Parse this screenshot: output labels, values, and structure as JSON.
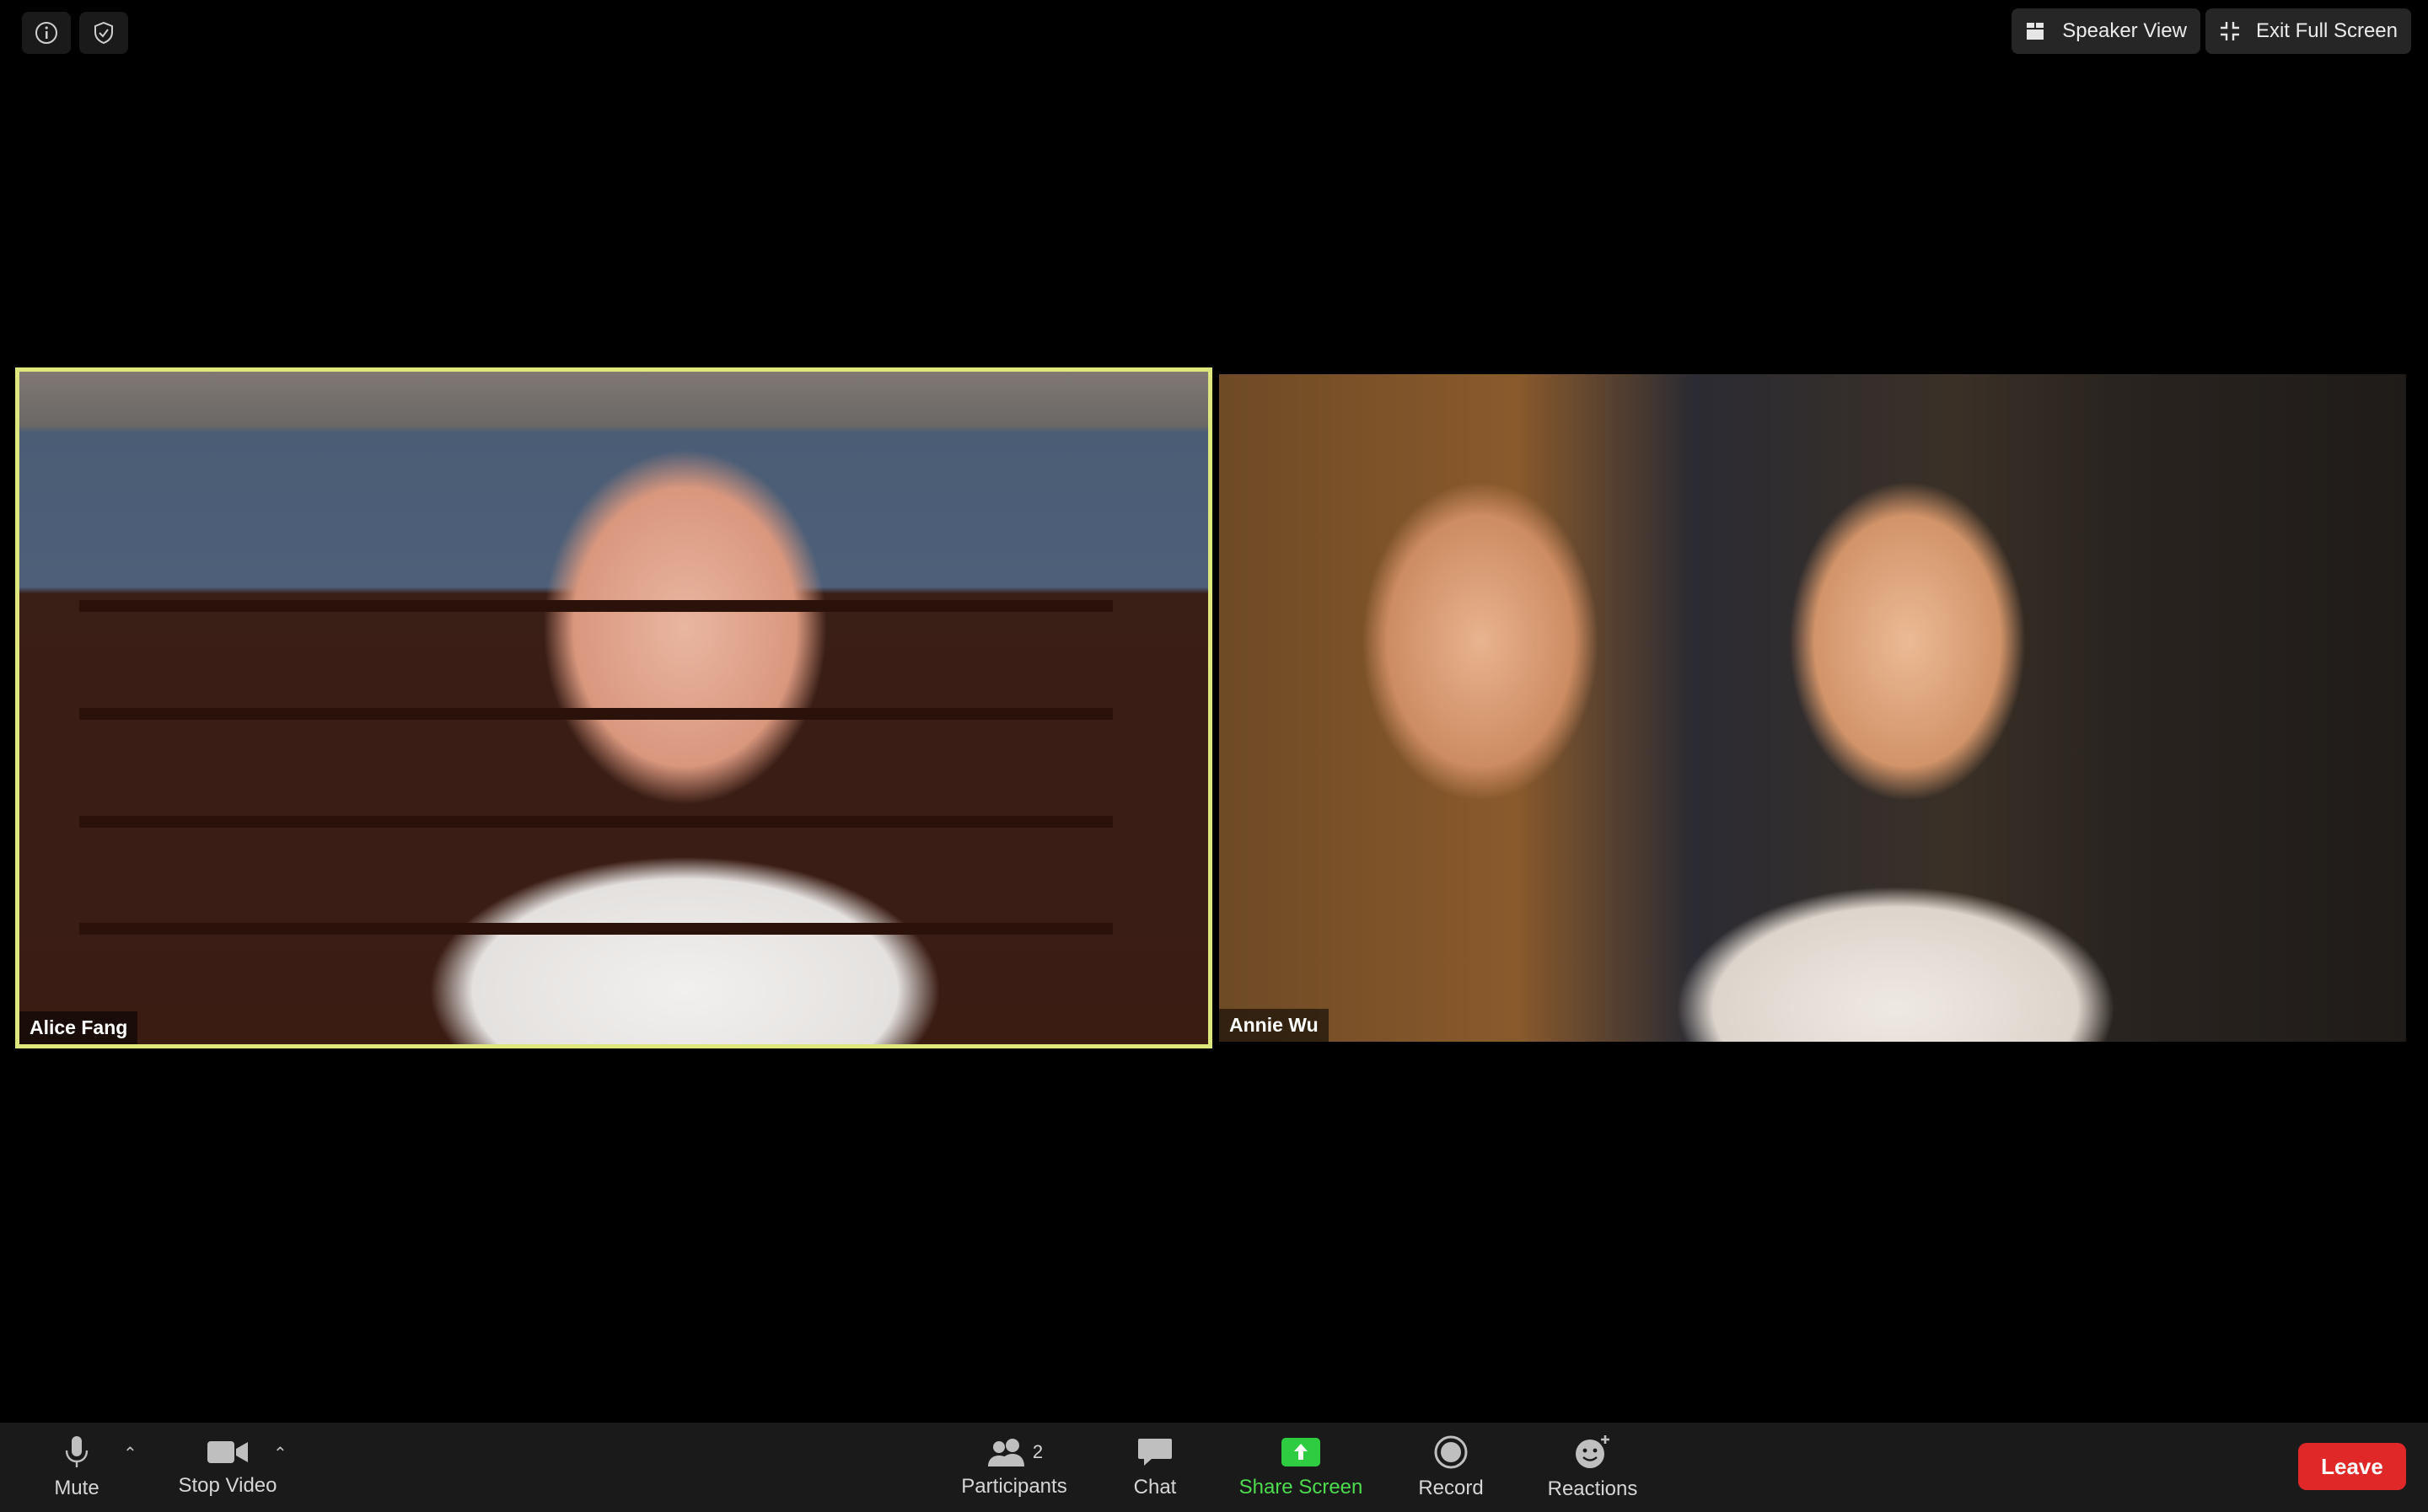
{
  "top_bar": {
    "speaker_view_label": "Speaker View",
    "exit_full_screen_label": "Exit Full Screen"
  },
  "participants_grid": [
    {
      "name": "Alice Fang",
      "active_speaker": true
    },
    {
      "name": "Annie Wu",
      "active_speaker": false
    }
  ],
  "toolbar": {
    "mute_label": "Mute",
    "stop_video_label": "Stop Video",
    "participants_label": "Participants",
    "participants_count": "2",
    "chat_label": "Chat",
    "share_screen_label": "Share Screen",
    "record_label": "Record",
    "reactions_label": "Reactions",
    "leave_label": "Leave"
  },
  "colors": {
    "active_speaker_border": "#dde77c",
    "share_screen": "#4ddc4d",
    "leave": "#e02828",
    "toolbar_bg": "#1a1a1a"
  },
  "icons": [
    "info-icon",
    "shield-check-icon",
    "grid-icon",
    "exit-fullscreen-icon",
    "microphone-icon",
    "video-camera-icon",
    "participants-icon",
    "chat-icon",
    "share-screen-icon",
    "record-icon",
    "reactions-icon"
  ]
}
